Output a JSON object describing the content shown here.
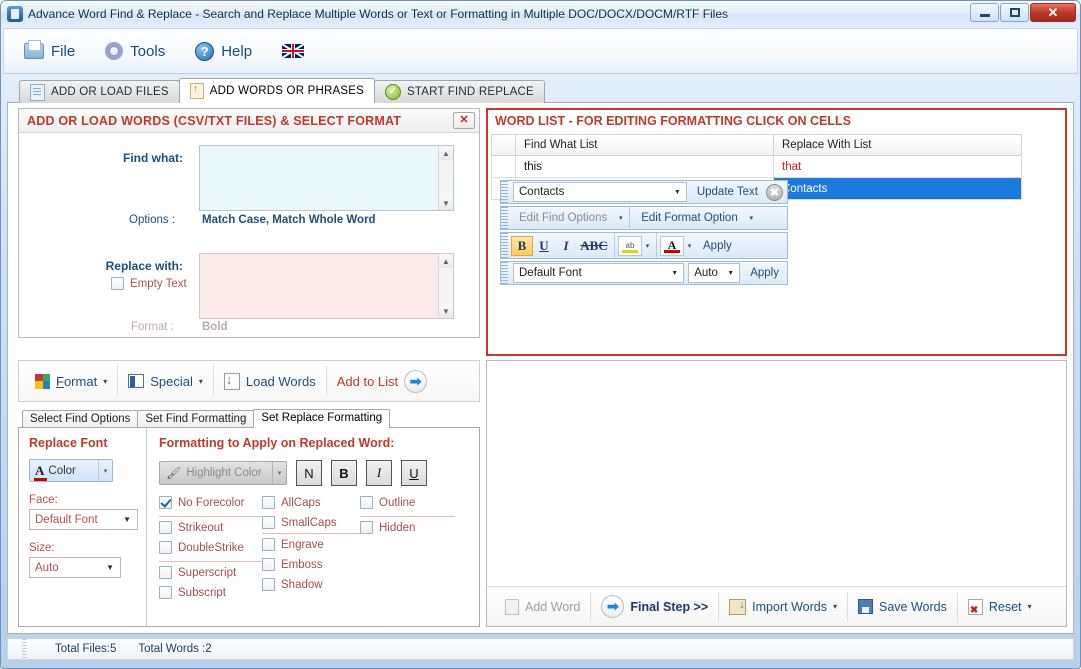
{
  "window": {
    "title": "Advance Word Find & Replace - Search and Replace Multiple Words or Text  or Formatting in Multiple DOC/DOCX/DOCM/RTF Files",
    "app_icon": "app-icon",
    "minimize_label": "",
    "maximize_label": "",
    "close_label": "✕"
  },
  "menubar": {
    "items": [
      {
        "label": "File",
        "icon": "folder-icon"
      },
      {
        "label": "Tools",
        "icon": "gear-icon"
      },
      {
        "label": "Help",
        "icon": "help-icon"
      },
      {
        "label": "",
        "icon": "uk-flag-icon"
      }
    ]
  },
  "tabs": [
    {
      "label": "ADD OR LOAD FILES",
      "icon": "files-icon",
      "active": false
    },
    {
      "label": "ADD WORDS OR PHRASES",
      "icon": "upload-icon",
      "active": true
    },
    {
      "label": "START FIND REPLACE",
      "icon": "green-check-icon",
      "active": false
    }
  ],
  "left_panel": {
    "title": "ADD OR LOAD WORDS (CSV/TXT FILES) & SELECT FORMAT",
    "close_button": "✕",
    "find_what_label": "Find what:",
    "find_what_value": "",
    "options_label": "Options :",
    "options_value": "Match Case, Match Whole Word",
    "replace_with_label": "Replace with:",
    "replace_with_value": "",
    "empty_text_label": "Empty Text",
    "empty_text_checked": false,
    "format_label": "Format :",
    "format_value": "Bold",
    "scroll_up": "▲",
    "scroll_down": "▼"
  },
  "format_toolbar": {
    "buttons": [
      {
        "label": "Format",
        "icon": "palette-icon",
        "has_caret": true
      },
      {
        "label": "Special",
        "icon": "special-icon",
        "has_caret": true
      },
      {
        "label": "Load Words",
        "icon": "download-icon",
        "has_caret": false
      },
      {
        "label": "Add to List",
        "icon": "blue-arrow-circle-icon",
        "has_caret": false
      }
    ]
  },
  "lower_tabs": {
    "items": [
      {
        "label": "Select Find Options",
        "active": false
      },
      {
        "label": "Set Find Formatting",
        "active": false
      },
      {
        "label": "Set Replace Formatting",
        "active": true
      }
    ],
    "replace_font_header": "Replace Font",
    "formatting_header": "Formatting to Apply on Replaced Word:",
    "color_button": "Color",
    "face_label": "Face:",
    "face_value": "Default Font",
    "size_label": "Size:",
    "size_value": "Auto",
    "highlight_color": "Highlight Color",
    "style_buttons": [
      "N",
      "B",
      "I",
      "U"
    ],
    "checkboxes_col1": [
      {
        "label": "No Forecolor",
        "checked": true
      },
      {
        "label": "Strikeout",
        "checked": false
      },
      {
        "label": "DoubleStrike",
        "checked": false
      },
      {
        "label": "Superscript",
        "checked": false
      },
      {
        "label": "Subscript",
        "checked": false
      }
    ],
    "checkboxes_col2": [
      {
        "label": "AllCaps",
        "checked": false
      },
      {
        "label": "SmallCaps",
        "checked": false
      },
      {
        "label": "Engrave",
        "checked": false
      },
      {
        "label": "Emboss",
        "checked": false
      },
      {
        "label": "Shadow",
        "checked": false
      }
    ],
    "checkboxes_col3": [
      {
        "label": "Outline",
        "checked": false
      },
      {
        "label": "Hidden",
        "checked": false
      }
    ]
  },
  "word_list": {
    "title": "WORD LIST - FOR EDITING FORMATTING CLICK ON CELLS",
    "columns": [
      "",
      "Find What List",
      "Replace With List"
    ],
    "rows": [
      {
        "marker": "",
        "find": "this",
        "replace": "that",
        "selected": false
      },
      {
        "marker": "▶",
        "find": "Contacts",
        "replace": "Contacts",
        "selected": true
      }
    ]
  },
  "cell_editor": {
    "combo_value": "Contacts",
    "update_text_label": "Update Text",
    "clear_button": "✖",
    "edit_find_options": "Edit Find Options",
    "edit_format_option": "Edit Format Option",
    "bold": "B",
    "underline": "U",
    "italic": "I",
    "strike": "ABC",
    "apply_label": "Apply",
    "font_value": "Default Font",
    "size_value": "Auto",
    "apply_label2": "Apply",
    "caret": "▾"
  },
  "bottom_bar": {
    "buttons": [
      {
        "label": "Add Word",
        "icon": "add-word-icon",
        "has_caret": false
      },
      {
        "label": "Final Step >>",
        "icon": "blue-arrow-circle-icon",
        "has_caret": false
      },
      {
        "label": "Import Words",
        "icon": "import-icon",
        "has_caret": true
      },
      {
        "label": "Save Words",
        "icon": "save-icon",
        "has_caret": false
      },
      {
        "label": "Reset",
        "icon": "reset-icon",
        "has_caret": true
      }
    ]
  },
  "status_bar": {
    "total_files": "Total Files:5",
    "total_words": "Total Words :2"
  }
}
